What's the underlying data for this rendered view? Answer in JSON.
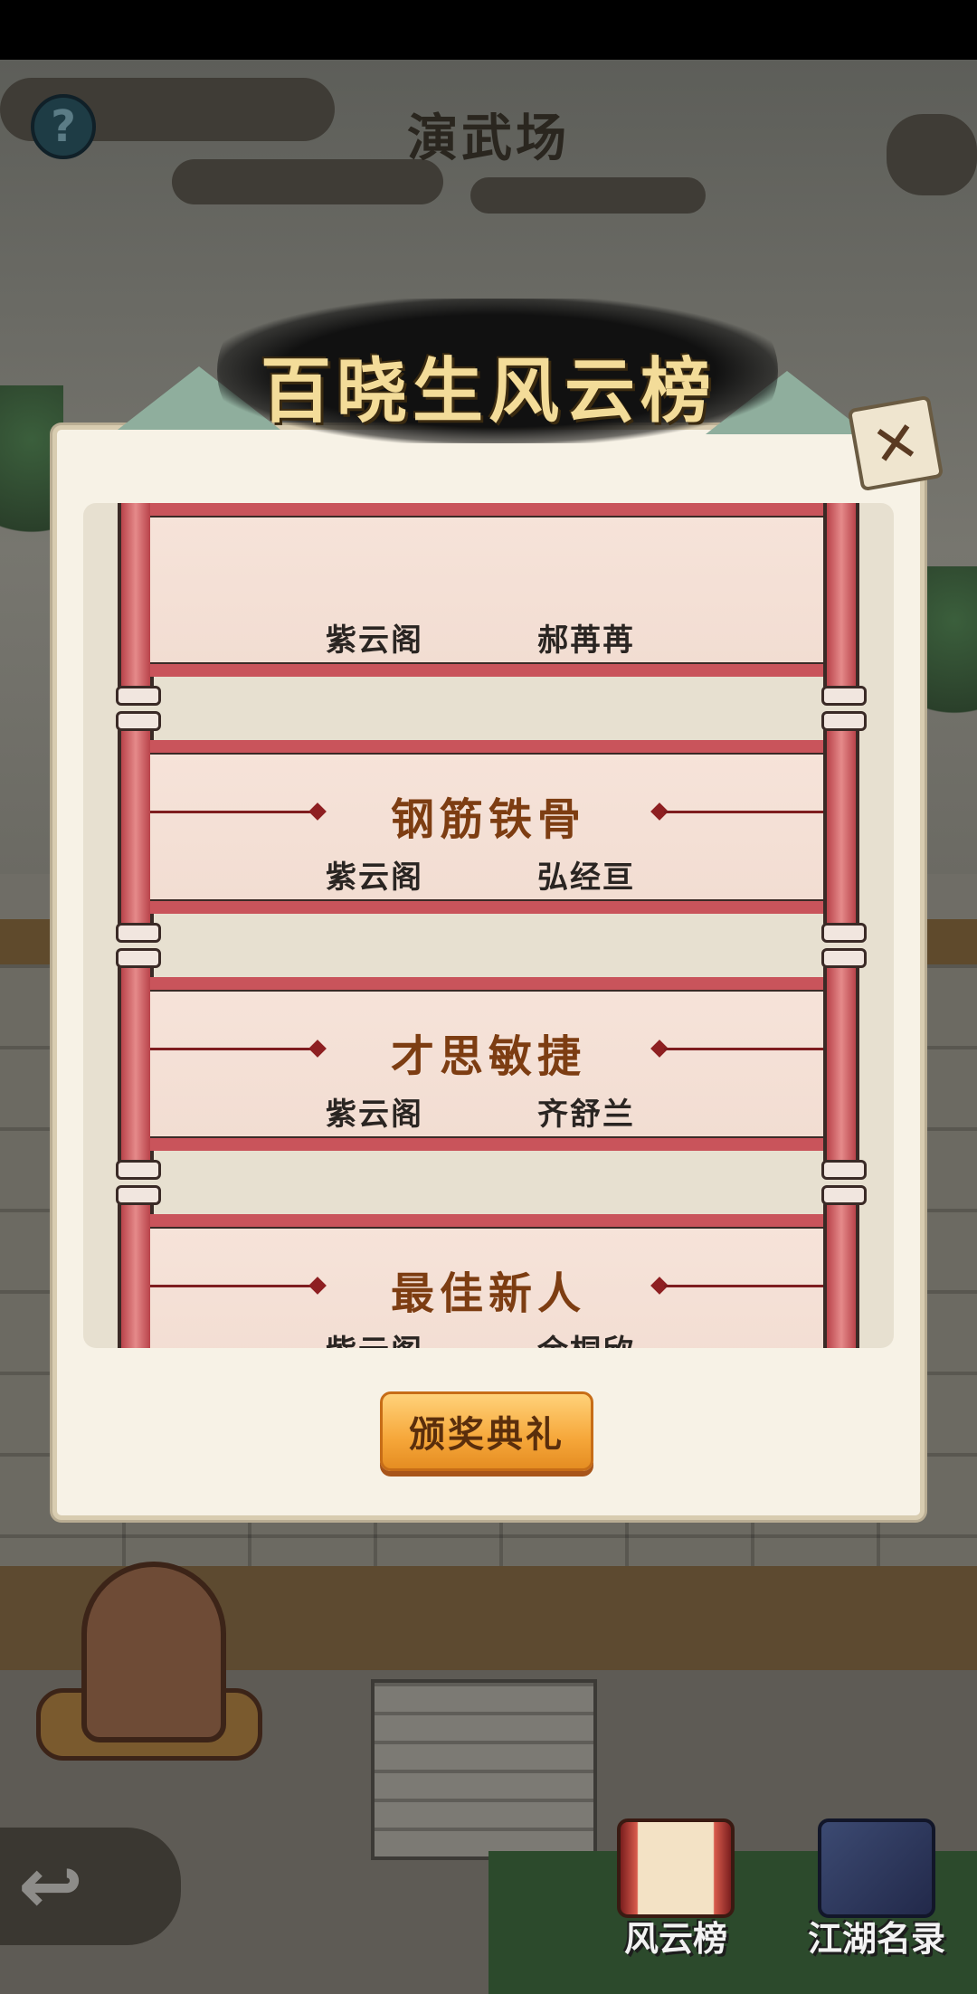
{
  "header": {
    "title": "演武场",
    "help_icon": "question-icon"
  },
  "dialog": {
    "banner_title": "百晓生风云榜",
    "close_icon": "close-icon",
    "awards": [
      {
        "title": "",
        "sect": "紫云阁",
        "winner": "郝苒苒"
      },
      {
        "title": "钢筋铁骨",
        "sect": "紫云阁",
        "winner": "弘经亘"
      },
      {
        "title": "才思敏捷",
        "sect": "紫云阁",
        "winner": "齐舒兰"
      },
      {
        "title": "最佳新人",
        "sect": "紫云阁",
        "winner": "余桐欣"
      }
    ],
    "ceremony_button": "颁奖典礼"
  },
  "bottom_nav": {
    "back_icon": "back-arrow-icon",
    "items": [
      {
        "label": "风云榜",
        "icon": "scroll-icon"
      },
      {
        "label": "江湖名录",
        "icon": "book-icon"
      }
    ]
  }
}
